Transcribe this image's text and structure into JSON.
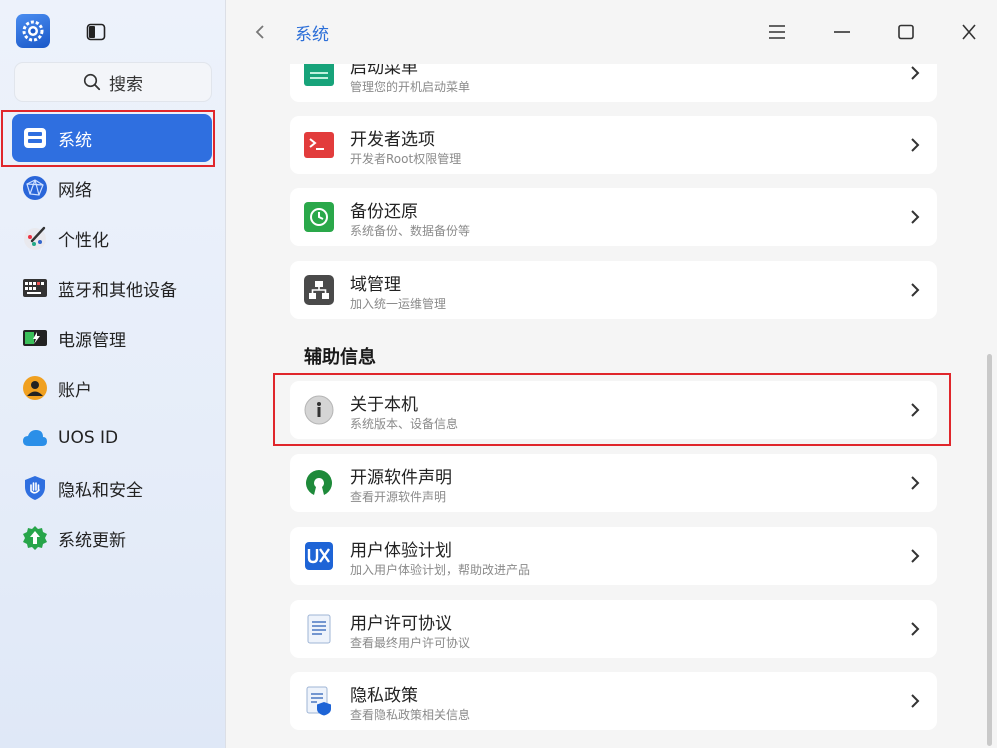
{
  "sidebar": {
    "search_label": "搜索",
    "items": [
      {
        "label": "系统",
        "icon": "system-icon",
        "active": true
      },
      {
        "label": "网络",
        "icon": "network-icon"
      },
      {
        "label": "个性化",
        "icon": "personalization-icon"
      },
      {
        "label": "蓝牙和其他设备",
        "icon": "bluetooth-devices-icon"
      },
      {
        "label": "电源管理",
        "icon": "power-icon"
      },
      {
        "label": "账户",
        "icon": "account-icon"
      },
      {
        "label": "UOS ID",
        "icon": "cloud-icon"
      },
      {
        "label": "隐私和安全",
        "icon": "privacy-shield-icon"
      },
      {
        "label": "系统更新",
        "icon": "update-icon"
      }
    ]
  },
  "header": {
    "title": "系统"
  },
  "cards": [
    {
      "title": "启动菜单",
      "subtitle": "管理您的开机启动菜单",
      "icon": "boot-menu-icon",
      "color": "#17a37a"
    },
    {
      "title": "开发者选项",
      "subtitle": "开发者Root权限管理",
      "icon": "terminal-icon",
      "color": "#e23c3c"
    },
    {
      "title": "备份还原",
      "subtitle": "系统备份、数据备份等",
      "icon": "backup-icon",
      "color": "#2aa84a"
    },
    {
      "title": "域管理",
      "subtitle": "加入统一运维管理",
      "icon": "domain-icon",
      "color": "#555555"
    }
  ],
  "section": {
    "title": "辅助信息"
  },
  "info_cards": [
    {
      "title": "关于本机",
      "subtitle": "系统版本、设备信息",
      "icon": "info-icon"
    },
    {
      "title": "开源软件声明",
      "subtitle": "查看开源软件声明",
      "icon": "open-source-icon"
    },
    {
      "title": "用户体验计划",
      "subtitle": "加入用户体验计划，帮助改进产品",
      "icon": "ux-icon"
    },
    {
      "title": "用户许可协议",
      "subtitle": "查看最终用户许可协议",
      "icon": "license-icon"
    },
    {
      "title": "隐私政策",
      "subtitle": "查看隐私政策相关信息",
      "icon": "privacy-policy-icon"
    }
  ],
  "colors": {
    "accent": "#2f6fe0",
    "highlight": "#e0262b"
  }
}
